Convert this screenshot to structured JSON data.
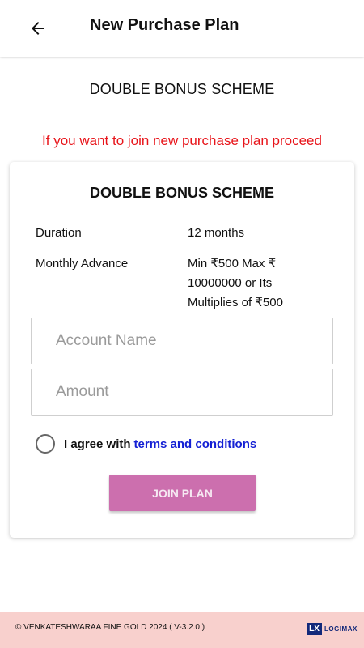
{
  "header": {
    "back_icon": "arrow-left-icon",
    "title": "New Purchase Plan"
  },
  "scheme_name": "DOUBLE BONUS SCHEME",
  "proceed_message": "If you want to join new purchase plan proceed",
  "card": {
    "title": "DOUBLE BONUS SCHEME",
    "duration_label": "Duration",
    "duration_value": "12 months",
    "advance_label": "Monthly Advance",
    "advance_value": "Min ₹500 Max ₹ 10000000 or Its Multiplies of ₹500",
    "account_name": {
      "value": "",
      "placeholder": "Account Name"
    },
    "amount": {
      "value": "",
      "placeholder": "Amount"
    },
    "agree_text": "I agree with",
    "terms_link": "terms and conditions",
    "join_label": "JOIN PLAN"
  },
  "footer": {
    "copyright": "© VENKATESHWARAA FINE GOLD 2024 ( V-3.2.0 )",
    "logo_mark": "LX",
    "logo_text": "LOGIMAX"
  },
  "colors": {
    "accent_button": "#cc6fae",
    "message_red": "#e8141a",
    "link_blue": "#1420d4",
    "footer_bg": "#f8d0cd"
  }
}
